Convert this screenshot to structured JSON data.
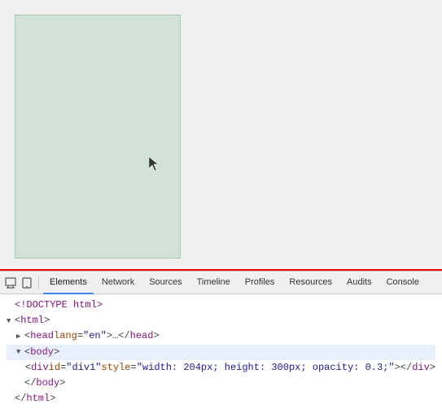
{
  "preview": {
    "div_style": "width: 204px; height: 300px; opacity: 0.3;"
  },
  "devtools": {
    "tabs": [
      {
        "id": "elements",
        "label": "Elements",
        "active": true
      },
      {
        "id": "network",
        "label": "Network",
        "active": false
      },
      {
        "id": "sources",
        "label": "Sources",
        "active": false
      },
      {
        "id": "timeline",
        "label": "Timeline",
        "active": false
      },
      {
        "id": "profiles",
        "label": "Profiles",
        "active": false
      },
      {
        "id": "resources",
        "label": "Resources",
        "active": false
      },
      {
        "id": "audits",
        "label": "Audits",
        "active": false
      },
      {
        "id": "console",
        "label": "Console",
        "active": false
      }
    ],
    "html": {
      "line1": "<!DOCTYPE html>",
      "line2": "<html>",
      "line3": "<head lang=\"en\">…</head>",
      "line4": "<body>",
      "line5": "<div id=\"div1\" style=\"width: 204px; height: 300px; opacity: 0.3;\"></div>",
      "line6": "</body>",
      "line7": "</html>"
    }
  }
}
